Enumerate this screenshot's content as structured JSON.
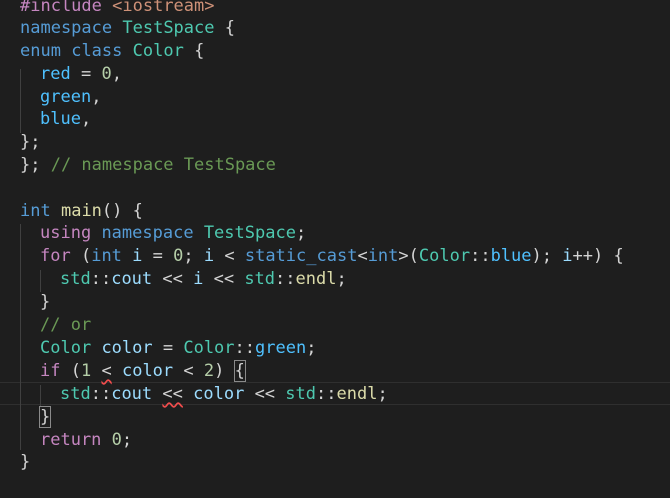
{
  "editor": {
    "l1": {
      "directive": "#include",
      "header": "<iostream>"
    },
    "l2": {
      "kw": "namespace",
      "name": "TestSpace",
      "brace": " {"
    },
    "l3": {
      "kw1": "enum",
      "kw2": "class",
      "name": "Color",
      "brace": " {"
    },
    "l4": {
      "name": "red",
      "eq": " = ",
      "num": "0",
      "punc": ","
    },
    "l5": {
      "name": "green",
      "punc": ","
    },
    "l6": {
      "name": "blue",
      "punc": ","
    },
    "l7": {
      "text": "};"
    },
    "l8": {
      "text": "}; ",
      "comment": "// namespace TestSpace"
    },
    "l10": {
      "kw": "int",
      "fn": "main",
      "rest": "() {"
    },
    "l11": {
      "kw1": "using",
      "kw2": "namespace",
      "name": "TestSpace",
      "punc": ";"
    },
    "l12": {
      "for": "for",
      "p1": " (",
      "int": "int",
      "i": "i",
      "eq": " = ",
      "zero": "0",
      "p2": "; ",
      "i2": "i",
      "lt": " < ",
      "cast": "static_cast",
      "lt2": "<",
      "int2": "int",
      ">(": ">(",
      "Color": "Color",
      "colons": "::",
      "blue": "blue",
      "p3": "); ",
      "i3": "i",
      "pp": "++",
      "p4": ") {"
    },
    "l13": {
      "std": "std",
      "colons": "::",
      "cout": "cout",
      "op": " << ",
      "i": "i",
      "op2": " << ",
      "std2": "std",
      "colons2": "::",
      "endl": "endl",
      "punc": ";"
    },
    "l14": {
      "text": "}"
    },
    "l15": {
      "comment": "// or"
    },
    "l16": {
      "type": "Color",
      "var": "color",
      "eq": " = ",
      "type2": "Color",
      "colons": "::",
      "green": "green",
      "punc": ";"
    },
    "l17": {
      "if": "if",
      "p1": " (",
      "one": "1",
      "sp": " ",
      "lt": "<",
      "sp2": " ",
      "var": "color",
      "lt2": " < ",
      "two": "2",
      "p2": ") ",
      "brace": "{"
    },
    "l18": {
      "std": "std",
      "colons": "::",
      "cout": "cout",
      "sp": " ",
      "op": "<<",
      "sp2": " ",
      "var": "color",
      "op2": " << ",
      "std2": "std",
      "colons2": "::",
      "endl": "endl",
      "punc": ";"
    },
    "l19": {
      "brace": "}"
    },
    "l20": {
      "kw": "return",
      "sp": " ",
      "num": "0",
      "punc": ";"
    },
    "l21": {
      "text": "}"
    }
  }
}
